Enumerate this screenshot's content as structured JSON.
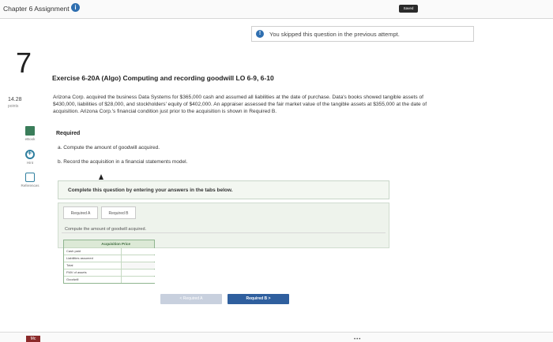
{
  "header": {
    "assignment_title": "Chapter 6 Assignment",
    "saved_label": "Saved"
  },
  "notice": {
    "text": "You skipped this question in the previous attempt."
  },
  "question": {
    "number": "7",
    "points_value": "14.28",
    "points_label": "points"
  },
  "side_tools": {
    "ebook_label": "eBook",
    "hint_label": "Hint",
    "references_label": "References"
  },
  "exercise": {
    "title": "Exercise 6-20A (Algo) Computing and recording goodwill LO 6-9, 6-10",
    "problem": "Arizona Corp. acquired the business Data Systems for $365,000 cash and assumed all liabilities at the date of purchase. Data's books showed tangible assets of $430,000, liabilities of $28,000, and stockholders' equity of $402,000. An appraiser assessed the fair market value of the tangible assets at $355,000 at the date of acquisition. Arizona Corp.'s financial condition just prior to the acquisition is shown in Required B.",
    "required_heading": "Required",
    "req_a": "a. Compute the amount of goodwill acquired.",
    "req_b": "b. Record the acquisition in a financial statements model."
  },
  "answer_area": {
    "instruction": "Complete this question by entering your answers in the tabs below.",
    "tabs": [
      {
        "label": "Required A"
      },
      {
        "label": "Required B"
      }
    ],
    "prompt": "Compute the amount of goodwill acquired.",
    "table": {
      "header": "Acquisition Price",
      "rows": [
        {
          "label": "Cash paid"
        },
        {
          "label": "Liabilities assumed"
        },
        {
          "label": "Total"
        },
        {
          "label": "FMV of assets"
        },
        {
          "label": "Goodwill"
        }
      ]
    }
  },
  "navigation": {
    "prev_label": "< Required A",
    "next_label": "Required B >"
  },
  "footer": {
    "me_label": "Mc"
  },
  "colors": {
    "accent_blue": "#2f6fb0",
    "next_button": "#2f5f9e",
    "panel_green": "#eef3ec"
  }
}
